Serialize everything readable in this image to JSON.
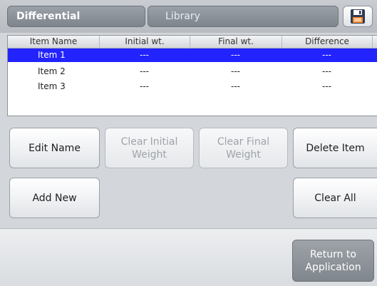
{
  "tabs": {
    "differential": "Differential",
    "library": "Library"
  },
  "table": {
    "headers": [
      "Item Name",
      "Initial wt.",
      "Final wt.",
      "Difference"
    ],
    "rows": [
      {
        "name": "Item 1",
        "initial": "---",
        "final": "---",
        "difference": "---",
        "selected": true
      },
      {
        "name": "Item 2",
        "initial": "---",
        "final": "---",
        "difference": "---",
        "selected": false
      },
      {
        "name": "Item 3",
        "initial": "---",
        "final": "---",
        "difference": "---",
        "selected": false
      }
    ]
  },
  "buttons": {
    "edit_name": "Edit Name",
    "clear_initial_1": "Clear Initial",
    "clear_initial_2": "Weight",
    "clear_final_1": "Clear Final",
    "clear_final_2": "Weight",
    "delete_item": "Delete Item",
    "add_new": "Add New",
    "clear_all": "Clear All",
    "return_1": "Return to",
    "return_2": "Application"
  },
  "icons": {
    "save": "floppy-disk-icon"
  }
}
